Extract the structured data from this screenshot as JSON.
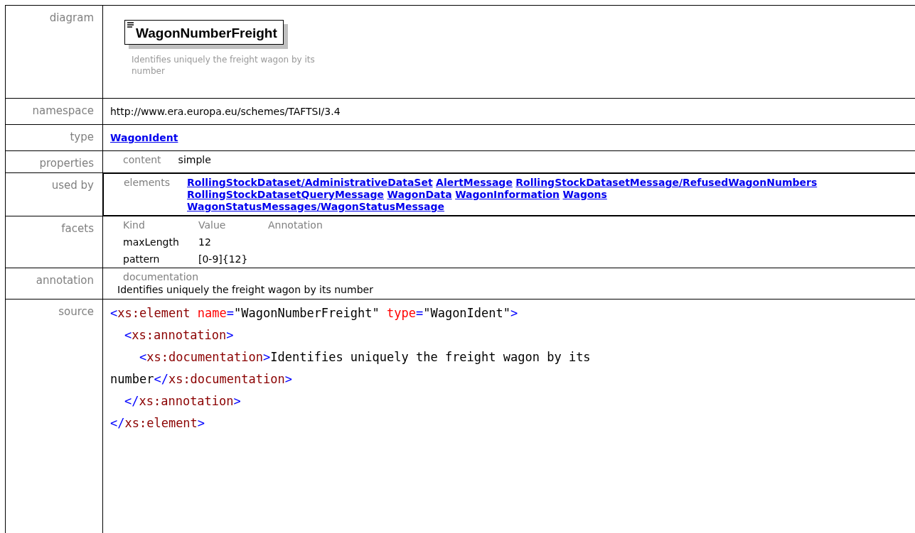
{
  "diagram": {
    "label": "diagram",
    "element_name": "WagonNumberFreight",
    "description": "Identifies uniquely the freight wagon by its number"
  },
  "namespace": {
    "label": "namespace",
    "value": "http://www.era.europa.eu/schemes/TAFTSI/3.4"
  },
  "type": {
    "label": "type",
    "value": "WagonIdent"
  },
  "properties": {
    "label": "properties",
    "key": "content",
    "value": "simple"
  },
  "used_by": {
    "label": "used by",
    "key": "elements",
    "links": [
      "RollingStockDataset/AdministrativeDataSet",
      "AlertMessage",
      "RollingStockDatasetMessage/RefusedWagonNumbers",
      "RollingStockDatasetQueryMessage",
      "WagonData",
      "WagonInformation",
      "Wagons",
      "WagonStatusMessages/WagonStatusMessage"
    ]
  },
  "facets": {
    "label": "facets",
    "columns": [
      "Kind",
      "Value",
      "Annotation"
    ],
    "rows": [
      {
        "kind": "maxLength",
        "value": "12"
      },
      {
        "kind": "pattern",
        "value": "[0-9]{12}"
      }
    ]
  },
  "annotation": {
    "label": "annotation",
    "key": "documentation",
    "text": "Identifies uniquely the freight wagon by its number"
  },
  "source": {
    "label": "source",
    "lines": [
      {
        "kind": "outer",
        "tokens": [
          {
            "kind": "bracket",
            "text": "<"
          },
          {
            "kind": "tag",
            "text": "xs:element "
          },
          {
            "kind": "attr",
            "text": "name"
          },
          {
            "kind": "bracket",
            "text": "="
          },
          {
            "kind": "value",
            "text": "\"WagonNumberFreight\" "
          },
          {
            "kind": "attr",
            "text": "type"
          },
          {
            "kind": "bracket",
            "text": "="
          },
          {
            "kind": "value",
            "text": "\"WagonIdent\""
          },
          {
            "kind": "bracket",
            "text": ">"
          }
        ]
      },
      {
        "kind": "inner",
        "tokens": [
          {
            "kind": "bracket",
            "text": "<"
          },
          {
            "kind": "tag",
            "text": "xs:annotation"
          },
          {
            "kind": "bracket",
            "text": ">"
          }
        ]
      },
      {
        "kind": "innermost",
        "tokens": [
          {
            "kind": "bracket",
            "text": "<"
          },
          {
            "kind": "tag",
            "text": "xs:documentation"
          },
          {
            "kind": "bracket",
            "text": ">"
          },
          {
            "kind": "value",
            "text": "Identifies uniquely the freight wagon by its"
          }
        ]
      },
      {
        "kind": "outer",
        "tokens": [
          {
            "kind": "value",
            "text": "number"
          },
          {
            "kind": "bracket",
            "text": "</"
          },
          {
            "kind": "tag",
            "text": "xs:documentation"
          },
          {
            "kind": "bracket",
            "text": ">"
          }
        ]
      },
      {
        "kind": "inner",
        "tokens": [
          {
            "kind": "bracket",
            "text": "</"
          },
          {
            "kind": "tag",
            "text": "xs:annotation"
          },
          {
            "kind": "bracket",
            "text": ">"
          }
        ]
      },
      {
        "kind": "outer",
        "tokens": [
          {
            "kind": "bracket",
            "text": "</"
          },
          {
            "kind": "tag",
            "text": "xs:element"
          },
          {
            "kind": "bracket",
            "text": ">"
          }
        ]
      }
    ]
  }
}
